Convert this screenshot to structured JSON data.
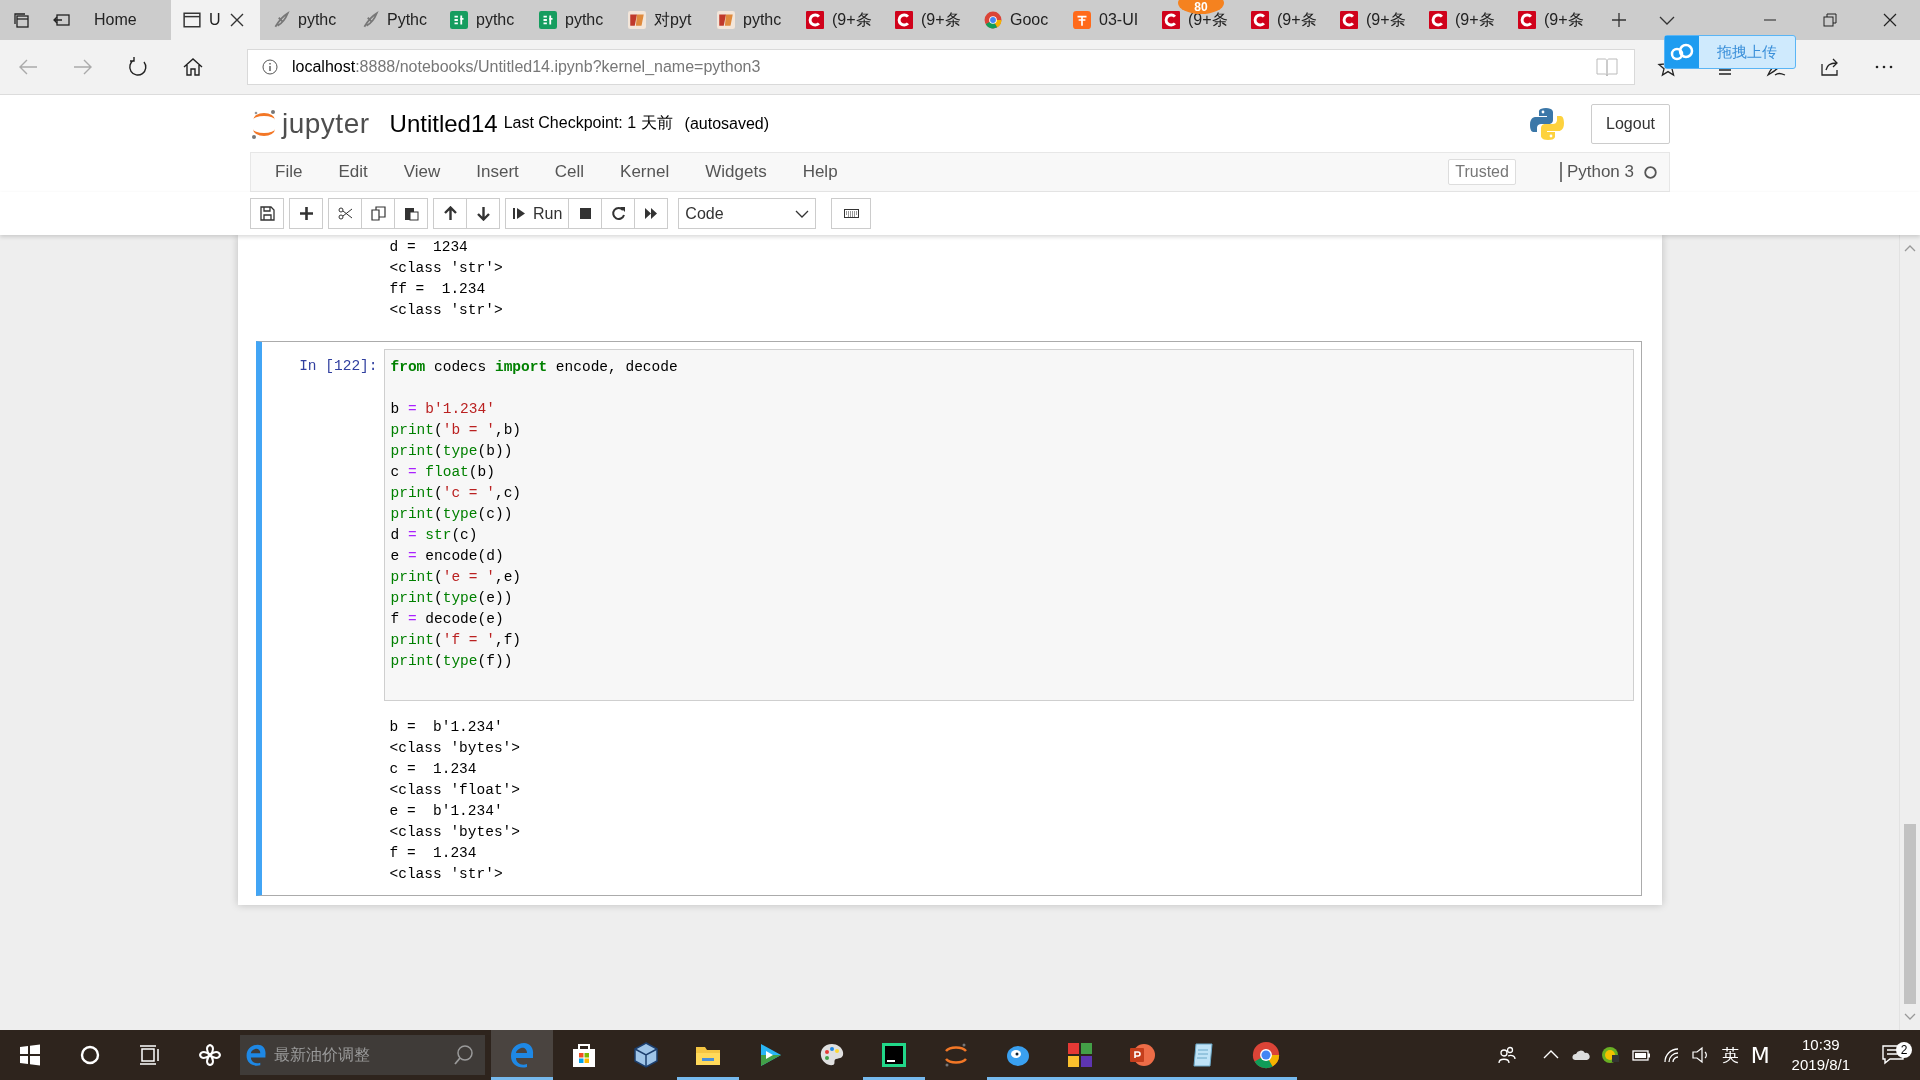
{
  "browser": {
    "tabs": [
      {
        "title": "Home",
        "kind": "none",
        "selected": false
      },
      {
        "title": "U",
        "kind": "page",
        "selected": true
      },
      {
        "title": "pythc",
        "kind": "feather",
        "selected": false
      },
      {
        "title": "Pythc",
        "kind": "feather",
        "selected": false
      },
      {
        "title": "pythc",
        "kind": "sf",
        "selected": false
      },
      {
        "title": "pythc",
        "kind": "sf",
        "selected": false
      },
      {
        "title": "对pyt",
        "kind": "jb",
        "selected": false
      },
      {
        "title": "pythc",
        "kind": "jb",
        "selected": false
      },
      {
        "title": "(9+条",
        "kind": "csdn",
        "selected": false
      },
      {
        "title": "(9+条",
        "kind": "csdn",
        "selected": false
      },
      {
        "title": "Gooc",
        "kind": "chrome",
        "selected": false
      },
      {
        "title": "03-UI",
        "kind": "taobao",
        "selected": false
      },
      {
        "title": "(9+条",
        "kind": "csdn",
        "selected": false,
        "badge": "80"
      },
      {
        "title": "(9+条",
        "kind": "csdn",
        "selected": false
      },
      {
        "title": "(9+条",
        "kind": "csdn",
        "selected": false
      },
      {
        "title": "(9+条",
        "kind": "csdn",
        "selected": false
      },
      {
        "title": "(9+条",
        "kind": "csdn",
        "selected": false
      }
    ],
    "address": {
      "host": "localhost",
      "path": ":8888/notebooks/Untitled14.ipynb?kernel_name=python3"
    },
    "upload_widget": {
      "label": "拖拽上传"
    }
  },
  "notebook": {
    "logo_text": "jupyter",
    "title": "Untitled14",
    "checkpoint": "Last Checkpoint: 1 天前",
    "autosave": "(autosaved)",
    "logout": "Logout",
    "menu": [
      "File",
      "Edit",
      "View",
      "Insert",
      "Cell",
      "Kernel",
      "Widgets",
      "Help"
    ],
    "trusted": "Trusted",
    "kernel": "Python 3",
    "kernel_busy": false,
    "toolbar": {
      "run": "Run",
      "cell_type": "Code"
    },
    "prev_output": [
      "d =  1234",
      "<class 'str'>",
      "ff =  1.234",
      "<class 'str'>"
    ],
    "cell": {
      "prompt": "In [122]:",
      "selected": true,
      "code": [
        {
          "tokens": [
            {
              "t": "from",
              "kind": "keyword"
            },
            {
              "t": " codecs ",
              "kind": "plain"
            },
            {
              "t": "import",
              "kind": "keyword"
            },
            {
              "t": " encode, decode",
              "kind": "plain"
            }
          ]
        },
        {
          "blank_before": true,
          "tokens": [
            {
              "t": "b ",
              "kind": "plain"
            },
            {
              "t": "=",
              "kind": "op"
            },
            {
              "t": " b'1.234'",
              "kind": "str"
            }
          ]
        },
        {
          "tokens": [
            {
              "t": "print",
              "kind": "builtin"
            },
            {
              "t": "(",
              "kind": "plain"
            },
            {
              "t": "'b = '",
              "kind": "str"
            },
            {
              "t": ",b)",
              "kind": "plain"
            }
          ]
        },
        {
          "tokens": [
            {
              "t": "print",
              "kind": "builtin"
            },
            {
              "t": "(",
              "kind": "plain"
            },
            {
              "t": "type",
              "kind": "builtin"
            },
            {
              "t": "(b))",
              "kind": "plain"
            }
          ]
        },
        {
          "tokens": [
            {
              "t": "c ",
              "kind": "plain"
            },
            {
              "t": "=",
              "kind": "op"
            },
            {
              "t": " float",
              "kind": "builtin"
            },
            {
              "t": "(b)",
              "kind": "plain"
            }
          ]
        },
        {
          "tokens": [
            {
              "t": "print",
              "kind": "builtin"
            },
            {
              "t": "(",
              "kind": "plain"
            },
            {
              "t": "'c = '",
              "kind": "str"
            },
            {
              "t": ",c)",
              "kind": "plain"
            }
          ]
        },
        {
          "tokens": [
            {
              "t": "print",
              "kind": "builtin"
            },
            {
              "t": "(",
              "kind": "plain"
            },
            {
              "t": "type",
              "kind": "builtin"
            },
            {
              "t": "(c))",
              "kind": "plain"
            }
          ]
        },
        {
          "tokens": [
            {
              "t": "d ",
              "kind": "plain"
            },
            {
              "t": "=",
              "kind": "op"
            },
            {
              "t": " str",
              "kind": "builtin"
            },
            {
              "t": "(c)",
              "kind": "plain"
            }
          ]
        },
        {
          "tokens": [
            {
              "t": "e ",
              "kind": "plain"
            },
            {
              "t": "=",
              "kind": "op"
            },
            {
              "t": " encode(d)",
              "kind": "plain"
            }
          ]
        },
        {
          "tokens": [
            {
              "t": "print",
              "kind": "builtin"
            },
            {
              "t": "(",
              "kind": "plain"
            },
            {
              "t": "'e = '",
              "kind": "str"
            },
            {
              "t": ",e)",
              "kind": "plain"
            }
          ]
        },
        {
          "tokens": [
            {
              "t": "print",
              "kind": "builtin"
            },
            {
              "t": "(",
              "kind": "plain"
            },
            {
              "t": "type",
              "kind": "builtin"
            },
            {
              "t": "(e))",
              "kind": "plain"
            }
          ]
        },
        {
          "tokens": [
            {
              "t": "f ",
              "kind": "plain"
            },
            {
              "t": "=",
              "kind": "op"
            },
            {
              "t": " decode(e)",
              "kind": "plain"
            }
          ]
        },
        {
          "tokens": [
            {
              "t": "print",
              "kind": "builtin"
            },
            {
              "t": "(",
              "kind": "plain"
            },
            {
              "t": "'f = '",
              "kind": "str"
            },
            {
              "t": ",f)",
              "kind": "plain"
            }
          ]
        },
        {
          "tokens": [
            {
              "t": "print",
              "kind": "builtin"
            },
            {
              "t": "(",
              "kind": "plain"
            },
            {
              "t": "type",
              "kind": "builtin"
            },
            {
              "t": "(f))",
              "kind": "plain"
            }
          ]
        }
      ],
      "output": [
        "b =  b'1.234'",
        "<class 'bytes'>",
        "c =  1.234",
        "<class 'float'>",
        "e =  b'1.234'",
        "<class 'bytes'>",
        "f =  1.234",
        "<class 'str'>"
      ]
    }
  },
  "taskbar": {
    "search_placeholder": "最新油价调整",
    "apps": [
      {
        "kind": "edge",
        "selected": true,
        "running": true
      },
      {
        "kind": "store",
        "selected": false,
        "running": false
      },
      {
        "kind": "cube",
        "selected": false,
        "running": false
      },
      {
        "kind": "folder",
        "selected": false,
        "running": true
      },
      {
        "kind": "player",
        "selected": false,
        "running": false
      },
      {
        "kind": "palette",
        "selected": false,
        "running": false
      },
      {
        "kind": "ide",
        "selected": false,
        "running": true
      },
      {
        "kind": "orbit",
        "selected": false,
        "running": false
      },
      {
        "kind": "bird",
        "selected": false,
        "running": true
      },
      {
        "kind": "squares",
        "selected": false,
        "running": true
      },
      {
        "kind": "slides",
        "selected": false,
        "running": true
      },
      {
        "kind": "notepad",
        "selected": false,
        "running": true
      },
      {
        "kind": "chrome",
        "selected": false,
        "running": true
      }
    ],
    "ime": "英",
    "ime_mode": "M",
    "time": "10:39",
    "date": "2019/8/1",
    "notifications": "2"
  }
}
